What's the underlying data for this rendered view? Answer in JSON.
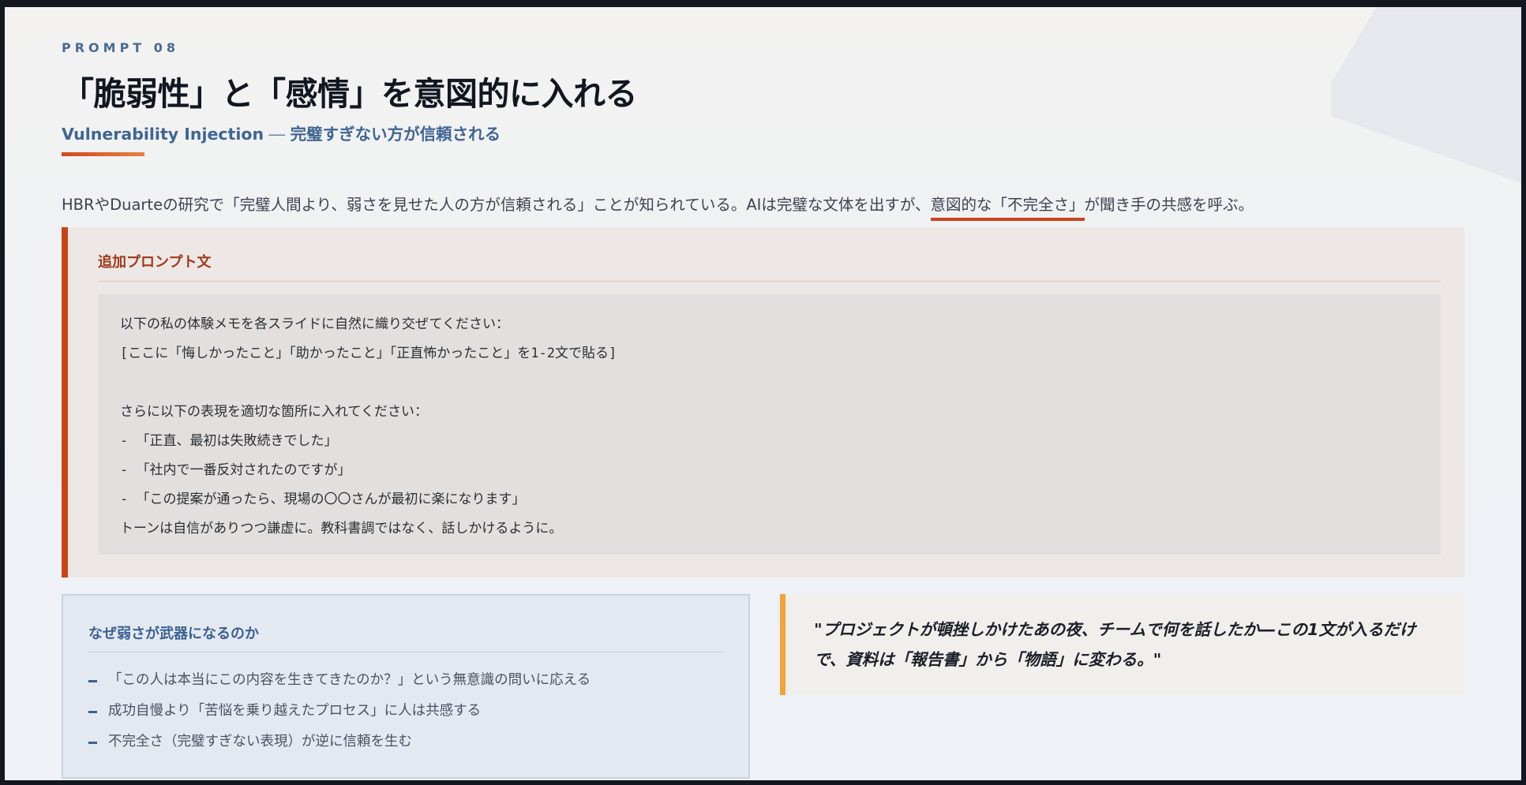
{
  "header": {
    "eyebrow": "PROMPT 08",
    "title": "「脆弱性」と「感情」を意図的に入れる",
    "subtitle_en": "Vulnerability Injection",
    "subtitle_dash": " ― ",
    "subtitle_jp": "完璧すぎない方が信頼される"
  },
  "intro": {
    "before": "HBRやDuarteの研究で「完璧人間より、弱さを見せた人の方が信頼される」ことが知られている。AIは完璧な文体を出すが、",
    "highlight": "意図的な「不完全さ」",
    "after": "が聞き手の共感を呼ぶ。"
  },
  "prompt_card": {
    "label": "追加プロンプト文",
    "lines": [
      "以下の私の体験メモを各スライドに自然に織り交ぜてください：",
      "[ここに「悔しかったこと」「助かったこと」「正直怖かったこと」を1-2文で貼る]",
      "",
      "さらに以下の表現を適切な箇所に入れてください：",
      "- 「正直、最初は失敗続きでした」",
      "- 「社内で一番反対されたのですが」",
      "- 「この提案が通ったら、現場の〇〇さんが最初に楽になります」",
      "トーンは自信がありつつ謙虚に。教科書調ではなく、話しかけるように。"
    ]
  },
  "why_card": {
    "title": "なぜ弱さが武器になるのか",
    "items": [
      "「この人は本当にこの内容を生きてきたのか？」という無意識の問いに応える",
      "成功自慢より「苦悩を乗り越えたプロセス」に人は共感する",
      "不完全さ（完璧すぎない表現）が逆に信頼を生む"
    ]
  },
  "quote_card": {
    "text": "\"プロジェクトが頓挫しかけたあの夜、チームで何を話したか―この1文が入るだけで、資料は「報告書」から「物語」に変わる。\""
  },
  "colors": {
    "accent_orange": "#c84416",
    "accent_blue": "#3a6192",
    "quote_bar": "#f0a43a",
    "title_text": "#121620"
  }
}
